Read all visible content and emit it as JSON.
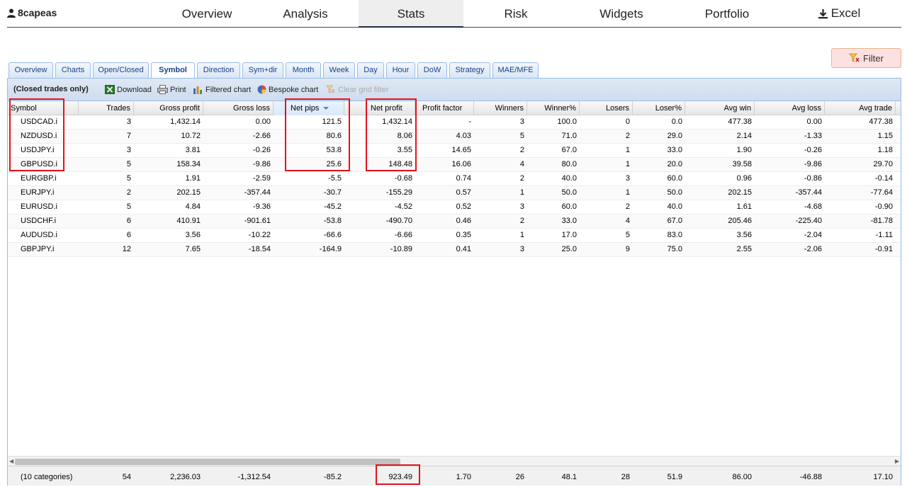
{
  "user": {
    "name": "8capeas"
  },
  "nav": [
    {
      "label": "Overview"
    },
    {
      "label": "Analysis"
    },
    {
      "label": "Stats"
    },
    {
      "label": "Risk"
    },
    {
      "label": "Widgets"
    },
    {
      "label": "Portfolio"
    },
    {
      "label": "Excel"
    }
  ],
  "filter_label": "Filter",
  "subtabs": [
    {
      "label": "Overview"
    },
    {
      "label": "Charts"
    },
    {
      "label": "Open/Closed"
    },
    {
      "label": "Symbol"
    },
    {
      "label": "Direction"
    },
    {
      "label": "Sym+dir"
    },
    {
      "label": "Month"
    },
    {
      "label": "Week"
    },
    {
      "label": "Day"
    },
    {
      "label": "Hour"
    },
    {
      "label": "DoW"
    },
    {
      "label": "Strategy"
    },
    {
      "label": "MAE/MFE"
    }
  ],
  "toolbar": {
    "label": "(Closed trades only)",
    "download": "Download",
    "print": "Print",
    "filtered_chart": "Filtered chart",
    "bespoke_chart": "Bespoke chart",
    "clear_filter": "Clear grid filter"
  },
  "columns": [
    "Symbol",
    "Trades",
    "Gross profit",
    "Gross loss",
    "Net pips",
    "Net profit",
    "Profit factor",
    "Winners",
    "Winner%",
    "Losers",
    "Loser%",
    "Avg win",
    "Avg loss",
    "Avg trade"
  ],
  "rows": [
    [
      "USDCAD.i",
      "3",
      "1,432.14",
      "0.00",
      "121.5",
      "1,432.14",
      "-",
      "3",
      "100.0",
      "0",
      "0.0",
      "477.38",
      "0.00",
      "477.38"
    ],
    [
      "NZDUSD.i",
      "7",
      "10.72",
      "-2.66",
      "80.6",
      "8.06",
      "4.03",
      "5",
      "71.0",
      "2",
      "29.0",
      "2.14",
      "-1.33",
      "1.15"
    ],
    [
      "USDJPY.i",
      "3",
      "3.81",
      "-0.26",
      "53.8",
      "3.55",
      "14.65",
      "2",
      "67.0",
      "1",
      "33.0",
      "1.90",
      "-0.26",
      "1.18"
    ],
    [
      "GBPUSD.i",
      "5",
      "158.34",
      "-9.86",
      "25.6",
      "148.48",
      "16.06",
      "4",
      "80.0",
      "1",
      "20.0",
      "39.58",
      "-9.86",
      "29.70"
    ],
    [
      "EURGBP.i",
      "5",
      "1.91",
      "-2.59",
      "-5.5",
      "-0.68",
      "0.74",
      "2",
      "40.0",
      "3",
      "60.0",
      "0.96",
      "-0.86",
      "-0.14"
    ],
    [
      "EURJPY.i",
      "2",
      "202.15",
      "-357.44",
      "-30.7",
      "-155.29",
      "0.57",
      "1",
      "50.0",
      "1",
      "50.0",
      "202.15",
      "-357.44",
      "-77.64"
    ],
    [
      "EURUSD.i",
      "5",
      "4.84",
      "-9.36",
      "-45.2",
      "-4.52",
      "0.52",
      "3",
      "60.0",
      "2",
      "40.0",
      "1.61",
      "-4.68",
      "-0.90"
    ],
    [
      "USDCHF.i",
      "6",
      "410.91",
      "-901.61",
      "-53.8",
      "-490.70",
      "0.46",
      "2",
      "33.0",
      "4",
      "67.0",
      "205.46",
      "-225.40",
      "-81.78"
    ],
    [
      "AUDUSD.i",
      "6",
      "3.56",
      "-10.22",
      "-66.6",
      "-6.66",
      "0.35",
      "1",
      "17.0",
      "5",
      "83.0",
      "3.56",
      "-2.04",
      "-1.11"
    ],
    [
      "GBPJPY.i",
      "12",
      "7.65",
      "-18.54",
      "-164.9",
      "-10.89",
      "0.41",
      "3",
      "25.0",
      "9",
      "75.0",
      "2.55",
      "-2.06",
      "-0.91"
    ]
  ],
  "totals": [
    "(10 categories)",
    "54",
    "2,236.03",
    "-1,312.54",
    "-85.2",
    "923.49",
    "1.70",
    "26",
    "48.1",
    "28",
    "51.9",
    "86.00",
    "-46.88",
    "17.10"
  ]
}
